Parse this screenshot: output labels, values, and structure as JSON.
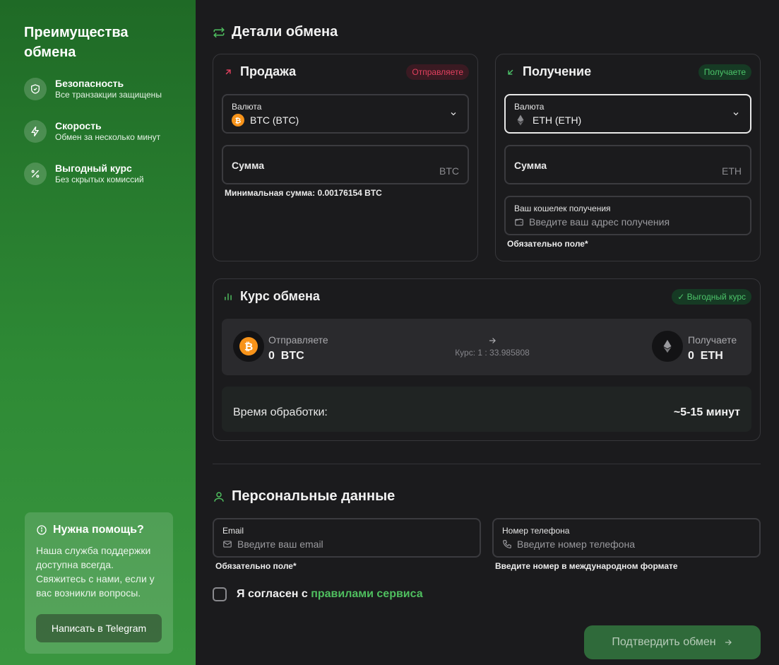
{
  "sidebar": {
    "title": "Преимущества обмена",
    "items": [
      {
        "title": "Безопасность",
        "desc": "Все транзакции защищены",
        "icon": "shield-icon"
      },
      {
        "title": "Скорость",
        "desc": "Обмен за несколько минут",
        "icon": "lightning-icon"
      },
      {
        "title": "Выгодный курс",
        "desc": "Без скрытых комиссий",
        "icon": "percent-icon"
      }
    ],
    "help": {
      "title": "Нужна помощь?",
      "text": "Наша служба поддержки доступна всегда. Свяжитесь с нами, если у вас возникли вопросы.",
      "button": "Написать в Telegram"
    }
  },
  "main": {
    "title": "Детали обмена",
    "sell": {
      "title": "Продажа",
      "badge": "Отправляете",
      "currency_label": "Валюта",
      "currency_value": "BTC (BTC)",
      "amount_label": "Сумма",
      "amount_unit": "BTC",
      "min_note": "Минимальная сумма: 0.00176154 BTC"
    },
    "receive": {
      "title": "Получение",
      "badge": "Получаете",
      "currency_label": "Валюта",
      "currency_value": "ETH (ETH)",
      "amount_label": "Сумма",
      "amount_unit": "ETH",
      "wallet_label": "Ваш кошелек получения",
      "wallet_placeholder": "Введите ваш адрес получения",
      "wallet_note": "Обязательно поле*"
    },
    "rate": {
      "title": "Курс обмена",
      "badge": "✓ Выгодный курс",
      "send_label": "Отправляете",
      "send_amount": "0",
      "send_unit": "BTC",
      "rate_text": "Курс: 1 : 33.985808",
      "recv_label": "Получаете",
      "recv_amount": "0",
      "recv_unit": "ETH",
      "time_label": "Время обработки:",
      "time_value": "~5-15 минут"
    },
    "personal": {
      "title": "Персональные данные",
      "email_label": "Email",
      "email_placeholder": "Введите ваш email",
      "email_note": "Обязательно поле*",
      "phone_label": "Номер телефона",
      "phone_placeholder": "Введите номер телефона",
      "phone_note": "Введите номер в международном формате"
    },
    "agree_text": "Я согласен с ",
    "agree_link": "правилами сервиса",
    "confirm_button": "Подтвердить обмен"
  },
  "colors": {
    "sidebar_green": "#2e8a35",
    "accent_green": "#4fbf5f",
    "sell_red": "#e0405e",
    "btc_orange": "#f7931a",
    "background": "#1b1b1d"
  }
}
